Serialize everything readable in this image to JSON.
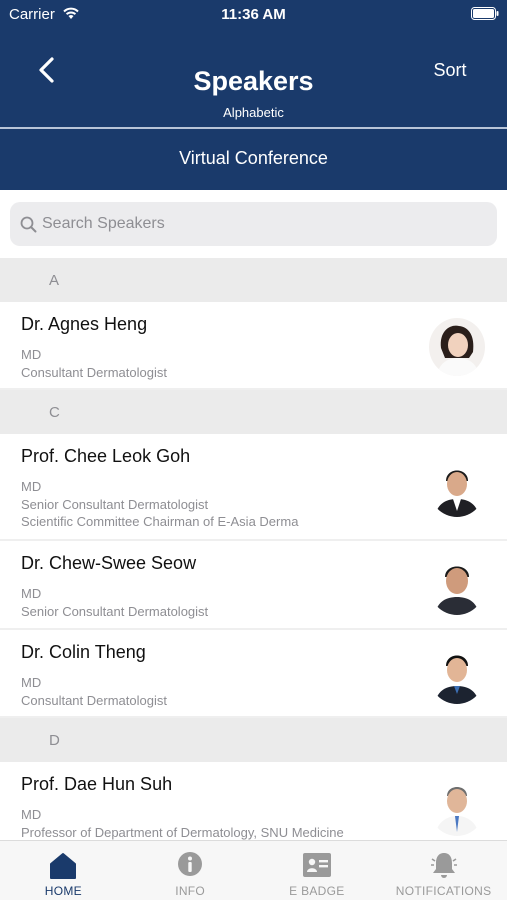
{
  "status_bar": {
    "carrier": "Carrier",
    "time": "11:36 AM"
  },
  "header": {
    "title": "Speakers",
    "subtitle": "Alphabetic",
    "sort_label": "Sort",
    "conference": "Virtual Conference"
  },
  "search": {
    "placeholder": "Search Speakers"
  },
  "sections": [
    {
      "letter": "A"
    },
    {
      "letter": "C"
    },
    {
      "letter": "D"
    }
  ],
  "speakers": [
    {
      "name": "Dr. Agnes Heng",
      "lines": [
        "MD",
        "Consultant Dermatologist"
      ]
    },
    {
      "name": "Prof. Chee Leok Goh",
      "lines": [
        "MD",
        "Senior Consultant Dermatologist",
        "Scientific Committee Chairman of E-Asia Derma"
      ]
    },
    {
      "name": "Dr. Chew-Swee Seow",
      "lines": [
        "MD",
        "Senior Consultant Dermatologist"
      ]
    },
    {
      "name": "Dr. Colin Theng",
      "lines": [
        "MD",
        "Consultant Dermatologist"
      ]
    },
    {
      "name": "Prof. Dae Hun Suh",
      "lines": [
        "MD",
        "Professor of Department of Dermatology, SNU Medicine"
      ]
    }
  ],
  "tabs": [
    {
      "label": "HOME",
      "icon": "home-icon",
      "active": true
    },
    {
      "label": "INFO",
      "icon": "info-icon",
      "active": false
    },
    {
      "label": "E BADGE",
      "icon": "badge-icon",
      "active": false
    },
    {
      "label": "NOTIFICATIONS",
      "icon": "bell-icon",
      "active": false
    }
  ],
  "colors": {
    "header_bg": "#1a3a6b",
    "active_tab": "#1a3a6b",
    "inactive_tab": "#9a9a9a",
    "section_bg": "#ebebeb"
  }
}
